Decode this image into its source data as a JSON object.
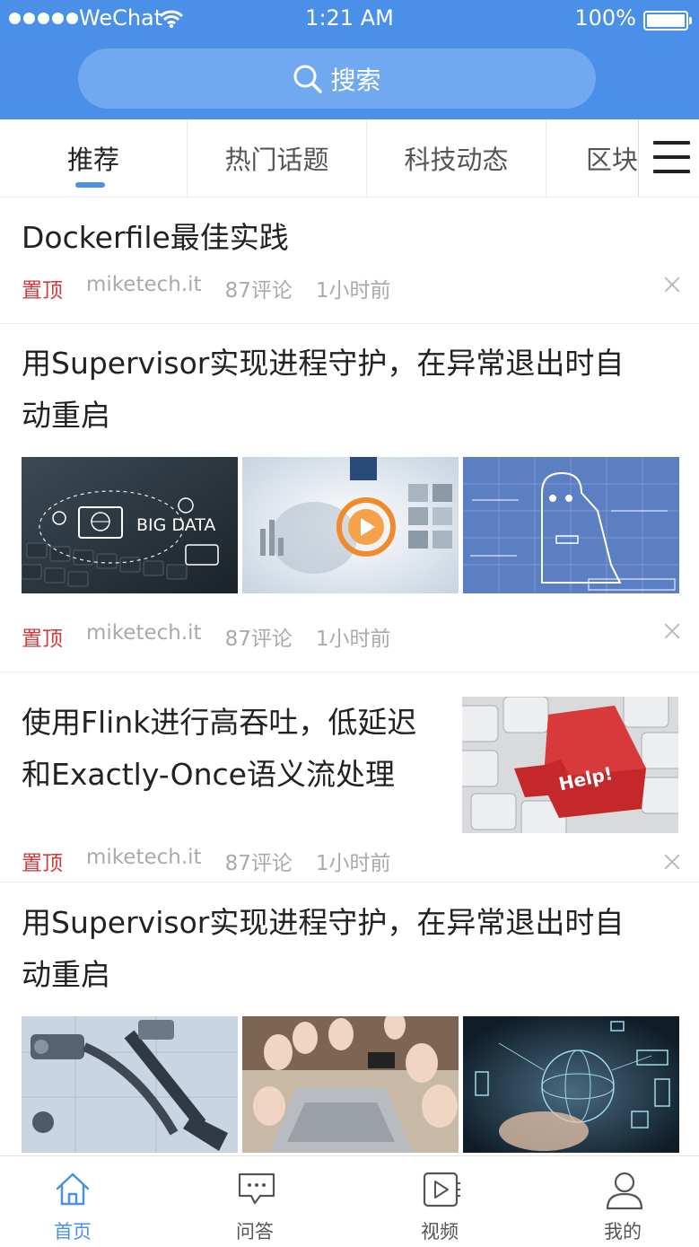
{
  "status_bar": {
    "carrier": "WeChat",
    "time": "1:21 AM",
    "battery": "100%"
  },
  "search": {
    "label": "搜索"
  },
  "tabs": [
    {
      "label": "推荐",
      "active": true
    },
    {
      "label": "热门话题",
      "active": false
    },
    {
      "label": "科技动态",
      "active": false
    },
    {
      "label": "区块链",
      "active": false
    }
  ],
  "articles": [
    {
      "title": "Dockerfile最佳实践",
      "pin": "置顶",
      "source": "miketech.it",
      "comments": "87评论",
      "time": "1小时前"
    },
    {
      "title_line1": "用Supervisor实现进程守护，在异常退出时自",
      "title_line2": "动重启",
      "pin": "置顶",
      "source": "miketech.it",
      "comments": "87评论",
      "time": "1小时前",
      "images": [
        "big-data-keyboard-image",
        "tech-touch-image",
        "robot-sketch-image"
      ],
      "image_text": [
        "BIG DATA"
      ]
    },
    {
      "title_line1": "使用Flink进行高吞吐，低延迟",
      "title_line2": "和Exactly-Once语义流处理",
      "pin": "置顶",
      "source": "miketech.it",
      "comments": "87评论",
      "time": "1小时前",
      "image": "help-key-image",
      "image_text": "Help!"
    },
    {
      "title_line1": "用Supervisor实现进程守护，在异常退出时自",
      "title_line2": "动重启",
      "images": [
        "tools-image",
        "thumbs-up-image",
        "globe-network-image"
      ]
    }
  ],
  "bottom_nav": [
    {
      "label": "首页",
      "icon": "home-icon",
      "active": true
    },
    {
      "label": "问答",
      "icon": "chat-icon",
      "active": false
    },
    {
      "label": "视频",
      "icon": "video-icon",
      "active": false
    },
    {
      "label": "我的",
      "icon": "user-icon",
      "active": false
    }
  ],
  "colors": {
    "primary": "#4a8fe8",
    "search_bg": "#71a9f1",
    "pin": "#d03a3a",
    "meta": "#aaaaaa"
  }
}
